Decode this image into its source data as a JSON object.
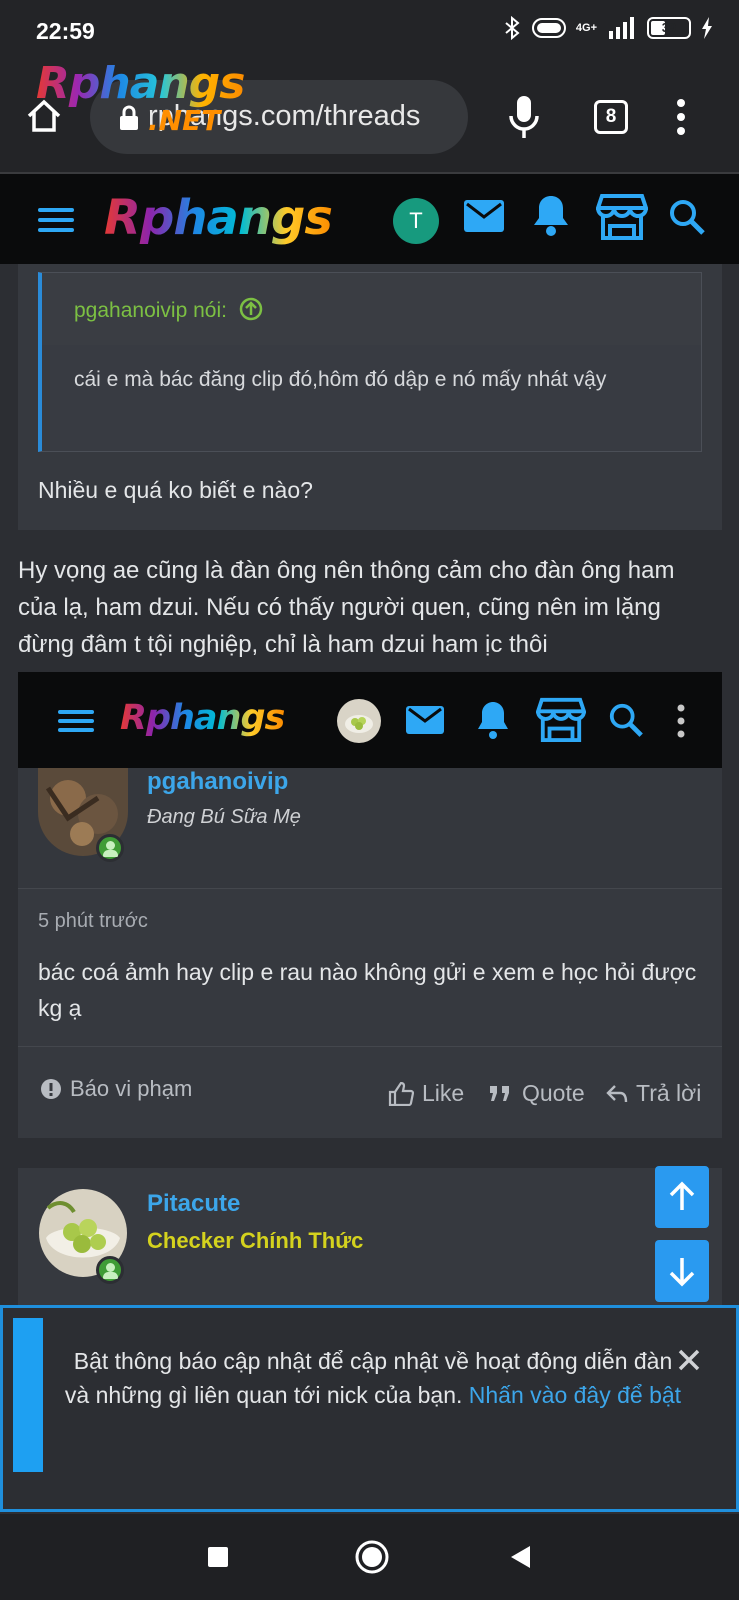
{
  "status_bar": {
    "time": "22:59",
    "network": "4G+",
    "battery": "39"
  },
  "browser": {
    "url": "rphangs.com/threads",
    "tab_count": "8",
    "overlay_logo": "Rphangs",
    "overlay_logo_suffix": ".NET"
  },
  "site_header": {
    "logo": "Rphangs",
    "avatar_letter": "T"
  },
  "quote": {
    "author": "pgahanoivip nói:",
    "text": "cái e mà bác đăng clip đó,hôm đó dập e nó mấy nhát vậy"
  },
  "reply_text": "Nhiều e quá ko biết e nào?",
  "post_body": "Hy vọng ae cũng là đàn ông nên thông cảm cho đàn ông ham của lạ, ham dzui. Nếu có thấy người quen, cũng nên im lặng đừng đâm t tội nghiệp, chỉ là ham dzui ham ịc thôi",
  "embedded_header": {
    "logo": "Rphangs"
  },
  "post1": {
    "username": "pgahanoivip",
    "user_title": "Đang Bú Sữa Mẹ",
    "time": "5 phút trước",
    "message": "bác coá ảmh hay clip e rau nào không gửi e xem e học hỏi được kg ạ",
    "actions": {
      "report": "Báo vi phạm",
      "like": "Like",
      "quote": "Quote",
      "reply": "Trả lời"
    }
  },
  "post2": {
    "username": "Pitacute",
    "user_title": "Checker Chính Thức"
  },
  "notice": {
    "text": "Bật thông báo cập nhật để cập nhật về hoạt động diễn đàn và những gì liên quan tới nick của bạn.",
    "link": "Nhấn vào đây để bật"
  },
  "colors": {
    "accent": "#2ea8f5",
    "link": "#3ca6ea",
    "quote_author": "#7cc043",
    "checker_title": "#d4d21e",
    "header_bg": "#0a0b0c"
  }
}
